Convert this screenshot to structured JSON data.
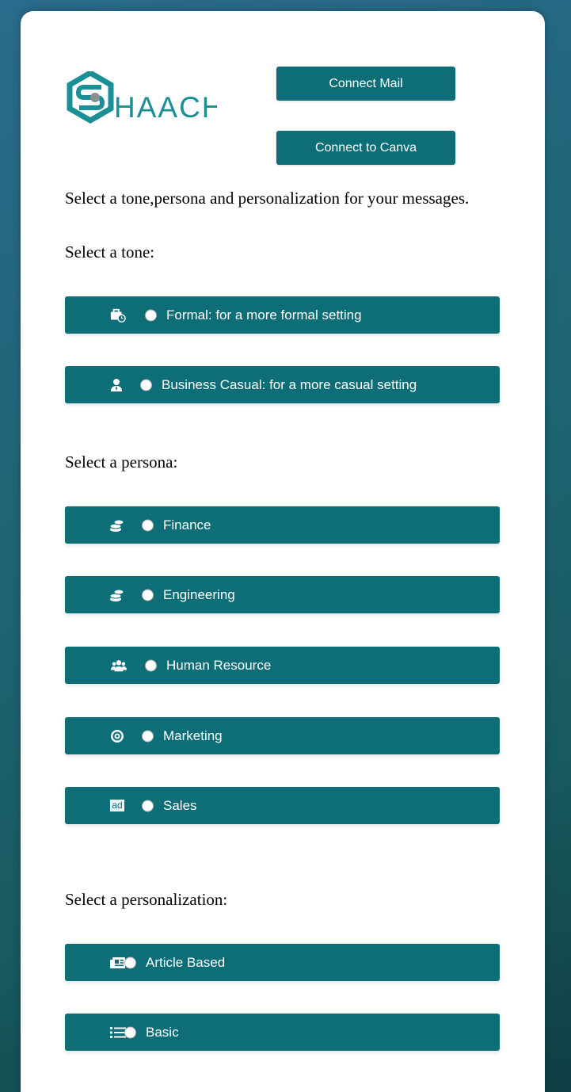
{
  "logo": {
    "text": "HAACHI",
    "mark": "S",
    "color": "#1a8f96"
  },
  "buttons": {
    "connect_mail": "Connect Mail",
    "connect_canva": "Connect to Canva"
  },
  "intro": "Select a tone,persona and personalization for your messages.",
  "tone": {
    "heading": "Select a tone:",
    "options": [
      {
        "label": "Formal: for a more formal setting",
        "icon": "briefcase-clock-icon"
      },
      {
        "label": "Business Casual: for a more casual setting",
        "icon": "user-tie-icon"
      }
    ]
  },
  "persona": {
    "heading": "Select a persona:",
    "options": [
      {
        "label": "Finance",
        "icon": "coins-icon"
      },
      {
        "label": "Engineering",
        "icon": "coins-icon"
      },
      {
        "label": "Human Resource",
        "icon": "users-icon"
      },
      {
        "label": "Marketing",
        "icon": "target-icon"
      },
      {
        "label": "Sales",
        "icon": "ad-icon",
        "icon_text": "ad"
      }
    ]
  },
  "personalization": {
    "heading": "Select a personalization:",
    "options": [
      {
        "label": "Article Based",
        "icon": "newspaper-icon"
      },
      {
        "label": "Basic",
        "icon": "list-icon"
      }
    ]
  },
  "colors": {
    "accent": "#0d6e77",
    "background": "#1e6472"
  }
}
